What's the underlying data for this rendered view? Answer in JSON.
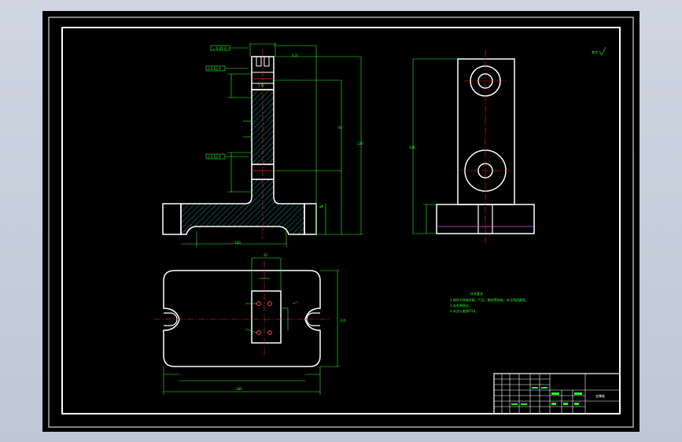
{
  "drawing": {
    "title_block_name": "支撑座",
    "tech_requirements": {
      "heading": "技术要求",
      "items": [
        "1.铸件不得有砂眼、气孔、裂纹等缺陷，未注铸造圆角。",
        "2.去毛刺锐边。",
        "3.未注公差按IT14。"
      ]
    },
    "roughness_note": "其余"
  }
}
